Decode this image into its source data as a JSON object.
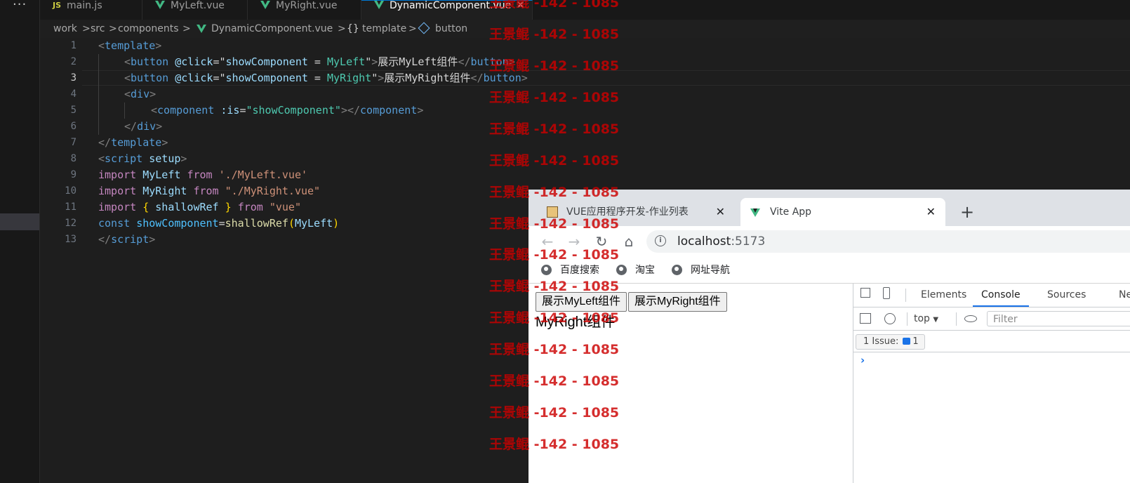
{
  "editor": {
    "activity_more": "···",
    "tabs": [
      {
        "icon": "JS",
        "label": "main.js"
      },
      {
        "icon": "vue",
        "label": "MyLeft.vue"
      },
      {
        "icon": "vue",
        "label": "MyRight.vue"
      },
      {
        "icon": "vue",
        "label": "DynamicComponent.vue",
        "active": true,
        "close": "✕"
      }
    ],
    "breadcrumb": {
      "work": "work",
      "src": "src",
      "components": "components",
      "file": "DynamicComponent.vue",
      "template_icon": "{}",
      "template": "template",
      "button": "button",
      "sep": ">"
    },
    "line_numbers": [
      "1",
      "2",
      "3",
      "4",
      "5",
      "6",
      "7",
      "8",
      "9",
      "10",
      "11",
      "12",
      "13"
    ],
    "current_line": 3,
    "code": {
      "l1": {
        "p0": "<",
        "p1": "template",
        "p2": ">"
      },
      "l2": {
        "p0": "<",
        "p1": "button",
        "p2": " ",
        "p3": "@click",
        "p4": "=",
        "p5": "\"",
        "p6": "showComponent",
        "p7": " = ",
        "p8": "MyLeft",
        "p9": "\"",
        "p10": ">",
        "p11": "展示MyLeft组件",
        "p12": "</",
        "p13": "button",
        "p14": ">"
      },
      "l3": {
        "p0": "<",
        "p1": "button",
        "p2": " ",
        "p3": "@click",
        "p4": "=",
        "p5": "\"",
        "p6": "showComponent",
        "p7": " = ",
        "p8": "MyRight",
        "p9": "\"",
        "p10": ">",
        "p11": "展示MyRight组件",
        "p12": "</",
        "p13": "button",
        "p14": ">"
      },
      "l4": {
        "p0": "<",
        "p1": "div",
        "p2": ">"
      },
      "l5": {
        "p0": "<",
        "p1": "component",
        "p2": " ",
        "p3": ":is",
        "p4": "=",
        "p5": "\"showComponent\"",
        "p6": "></",
        "p7": "component",
        "p8": ">"
      },
      "l6": {
        "p0": "</",
        "p1": "div",
        "p2": ">"
      },
      "l7": {
        "p0": "</",
        "p1": "template",
        "p2": ">"
      },
      "l8": {
        "p0": "<",
        "p1": "script",
        "p2": " ",
        "p3": "setup",
        "p4": ">"
      },
      "l9": {
        "p0": "import",
        "p1": " ",
        "p2": "MyLeft",
        "p3": " ",
        "p4": "from",
        "p5": " ",
        "p6": "'./MyLeft.vue'"
      },
      "l10": {
        "p0": "import",
        "p1": " ",
        "p2": "MyRight",
        "p3": " ",
        "p4": "from",
        "p5": " ",
        "p6": "\"./MyRight.vue\""
      },
      "l11": {
        "p0": "import",
        "p1": " ",
        "p2": "{",
        "p3": " shallowRef ",
        "p4": "}",
        "p5": " ",
        "p6": "from",
        "p7": " ",
        "p8": "\"vue\""
      },
      "l12": {
        "p0": "const",
        "p1": " ",
        "p2": "showComponent",
        "p3": "=",
        "p4": "shallowRef",
        "p5": "(",
        "p6": "MyLeft",
        "p7": ")"
      },
      "l13": {
        "p0": "</",
        "p1": "script",
        "p2": ">"
      }
    }
  },
  "browser": {
    "tabs": [
      {
        "label": "VUE应用程序开发-作业列表",
        "close": "✕"
      },
      {
        "label": "Vite App",
        "close": "✕",
        "active": true
      }
    ],
    "new_tab": "+",
    "nav": {
      "back": "←",
      "forward": "→",
      "reload": "↻",
      "home": "⌂",
      "info": "i"
    },
    "address": {
      "host": "localhost",
      "port": ":5173"
    },
    "bookmarks": [
      "百度搜索",
      "淘宝",
      "网址导航"
    ],
    "page": {
      "buttons": [
        "展示MyLeft组件",
        "展示MyRight组件"
      ],
      "text": "MyRight组件"
    },
    "devtools": {
      "tabs": [
        "Elements",
        "Console",
        "Sources",
        "Ne"
      ],
      "active_tab": "Console",
      "context": "top",
      "context_caret": "▼",
      "filter_placeholder": "Filter",
      "issues_label": "1 Issue:",
      "issues_count": "1",
      "prompt": "›"
    }
  },
  "watermark": {
    "text": "王景鲲 -142 - 1085",
    "color": "#cc0000"
  },
  "colors": {
    "vue_green": "#41b883",
    "accent_blue": "#1a73e8",
    "vscode_bg": "#1e1e1e"
  }
}
